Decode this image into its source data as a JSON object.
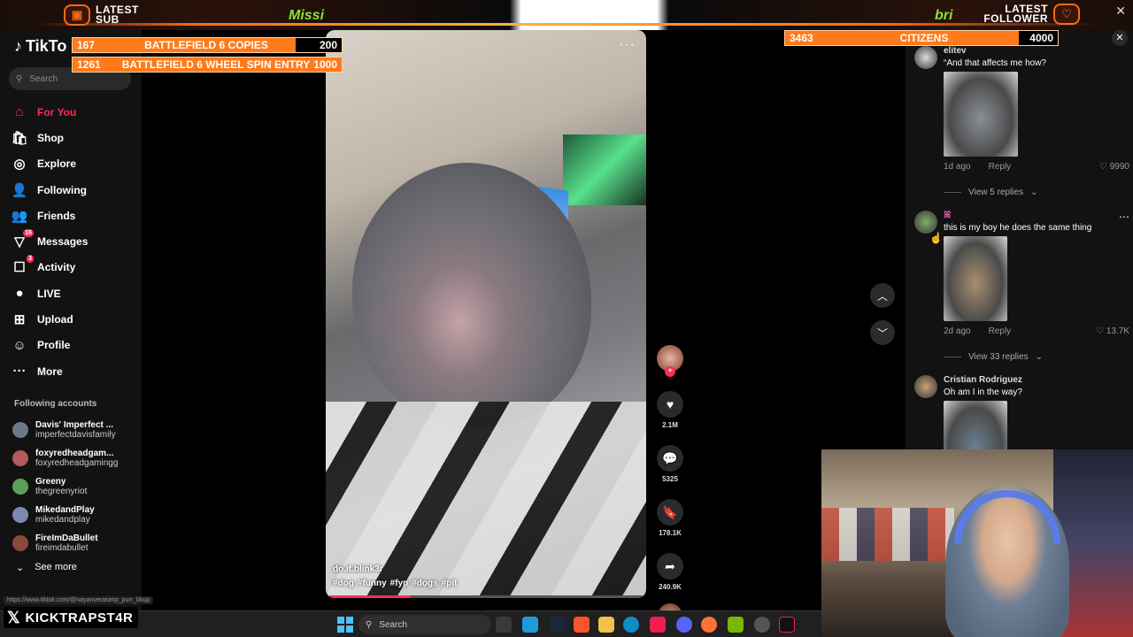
{
  "overlay": {
    "latest_sub_line1": "LATEST",
    "latest_sub_line2": "SUB",
    "ticker_left": "Missi",
    "ticker_right": "bri",
    "latest_follower_line1": "LATEST",
    "latest_follower_line2": "FOLLOWER",
    "goals": [
      {
        "count": "167",
        "label": "BATTLEFIELD 6 COPIES",
        "target": "200"
      },
      {
        "count": "1261",
        "label": "BATTLEFIELD 6 WHEEL SPIN ENTRY",
        "target": "1000"
      },
      {
        "count": "3463",
        "label": "CITIZENS",
        "target": "4000"
      }
    ],
    "handle": "KICKTRAPST4R",
    "accent_color": "#ff6a13"
  },
  "tiktok": {
    "logo": "TikTo",
    "search_placeholder": "Search",
    "nav": [
      {
        "label": "For You",
        "icon": "home-icon",
        "glyph": "⌂",
        "active": true,
        "badge": ""
      },
      {
        "label": "Shop",
        "icon": "shop-icon",
        "glyph": "🛍",
        "active": false,
        "badge": ""
      },
      {
        "label": "Explore",
        "icon": "compass-icon",
        "glyph": "◎",
        "active": false,
        "badge": ""
      },
      {
        "label": "Following",
        "icon": "following-icon",
        "glyph": "👤",
        "active": false,
        "badge": ""
      },
      {
        "label": "Friends",
        "icon": "friends-icon",
        "glyph": "👥",
        "active": false,
        "badge": ""
      },
      {
        "label": "Messages",
        "icon": "messages-icon",
        "glyph": "▽",
        "active": false,
        "badge": "16"
      },
      {
        "label": "Activity",
        "icon": "activity-icon",
        "glyph": "☐",
        "active": false,
        "badge": "3"
      },
      {
        "label": "LIVE",
        "icon": "live-icon",
        "glyph": "●",
        "active": false,
        "badge": ""
      },
      {
        "label": "Upload",
        "icon": "upload-icon",
        "glyph": "⊞",
        "active": false,
        "badge": ""
      },
      {
        "label": "Profile",
        "icon": "profile-icon",
        "glyph": "☺",
        "active": false,
        "badge": ""
      },
      {
        "label": "More",
        "icon": "more-icon",
        "glyph": "···",
        "active": false,
        "badge": ""
      }
    ],
    "following_header": "Following accounts",
    "accounts": [
      {
        "name": "Davis' Imperfect ...",
        "handle": "imperfectdavisfamily",
        "color": "#6b7a8a"
      },
      {
        "name": "foxyredheadgam...",
        "handle": "foxyredheadgamingg",
        "color": "#b35a5a"
      },
      {
        "name": "Greeny",
        "handle": "thegreenyriot",
        "color": "#5aa05a"
      },
      {
        "name": "MikedandPlay",
        "handle": "mikedandplay",
        "color": "#7a8ab3"
      },
      {
        "name": "FireImDaBullet",
        "handle": "fireimdabullet",
        "color": "#8a4a3a"
      }
    ],
    "see_more": "See more",
    "url_tooltip": "https://www.tiktok.com/@nayanverasimp_purr_bkup"
  },
  "video": {
    "author": "do.it.blink3r",
    "hashtags": [
      "#dog",
      "#funny",
      "#fyp",
      "#dogs",
      "#pit"
    ],
    "likes": "2.1M",
    "comments": "5325",
    "saves": "178.1K",
    "shares": "240.9K",
    "progress": 0.26
  },
  "comments": [
    {
      "user": "elitev",
      "text": "“And that affects me how?",
      "age": "1d ago",
      "reply": "Reply",
      "likes": "9990",
      "replies": "View 5 replies",
      "avatar_color": "#dcdcdc",
      "thumb": "#8a8f96"
    },
    {
      "user": "ꕤ",
      "text": "this is my boy he does the same thing",
      "age": "2d ago",
      "reply": "Reply",
      "likes": "13.7K",
      "replies": "View 33 replies",
      "avatar_color": "#7fae6a",
      "thumb": "#a89070"
    },
    {
      "user": "Cristian Rodriguez",
      "text": "Oh am I in the way?",
      "avatar_color": "#c9a07a",
      "thumb": "#6c8090"
    }
  ],
  "taskbar": {
    "search_placeholder": "Search"
  }
}
